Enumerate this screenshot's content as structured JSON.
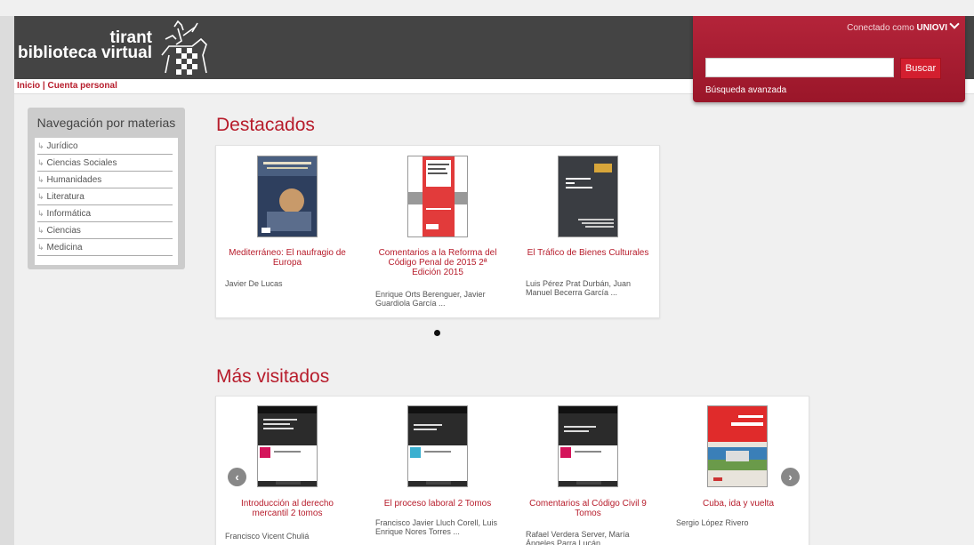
{
  "logo": {
    "line1": "tirant",
    "line2": "biblioteca virtual"
  },
  "nav": {
    "home": "Inicio",
    "separator": "|",
    "account": "Cuenta personal"
  },
  "session": {
    "prefix": "Conectado como",
    "user": "UNIOVI"
  },
  "search": {
    "value": "",
    "placeholder": "",
    "button": "Buscar",
    "advanced": "Búsqueda avanzada"
  },
  "sidebar": {
    "title": "Navegación por materias",
    "items": [
      {
        "label": "Jurídico"
      },
      {
        "label": "Ciencias Sociales"
      },
      {
        "label": "Humanidades"
      },
      {
        "label": "Literatura"
      },
      {
        "label": "Informática"
      },
      {
        "label": "Ciencias"
      },
      {
        "label": "Medicina"
      }
    ]
  },
  "featured": {
    "title": "Destacados",
    "books": [
      {
        "title": "Mediterráneo: El naufragio de Europa",
        "author": "Javier De Lucas"
      },
      {
        "title": "Comentarios a la Reforma del Código Penal de 2015 2ª Edición 2015",
        "author": "Enrique Orts Berenguer, Javier Guardiola García ..."
      },
      {
        "title": "El Tráfico de Bienes Culturales",
        "author": "Luis Pérez Prat Durbán, Juan Manuel Becerra García ..."
      }
    ]
  },
  "most_visited": {
    "title": "Más visitados",
    "books": [
      {
        "title": "Introducción al derecho mercantil 2 tomos",
        "author": "Francisco Vicent Chuliá"
      },
      {
        "title": "El proceso laboral 2 Tomos",
        "author": "Francisco Javier Lluch Corell, Luis Enrique Nores Torres ..."
      },
      {
        "title": "Comentarios al Código Civil 9 Tomos",
        "author": "Rafael Verdera Server, María Ángeles Parra Lucán ..."
      },
      {
        "title": "Cuba, ida y vuelta",
        "author": "Sergio López Rivero"
      }
    ]
  },
  "colors": {
    "accent": "#b71c2b",
    "header": "#444444",
    "panel": "#a81d33"
  }
}
